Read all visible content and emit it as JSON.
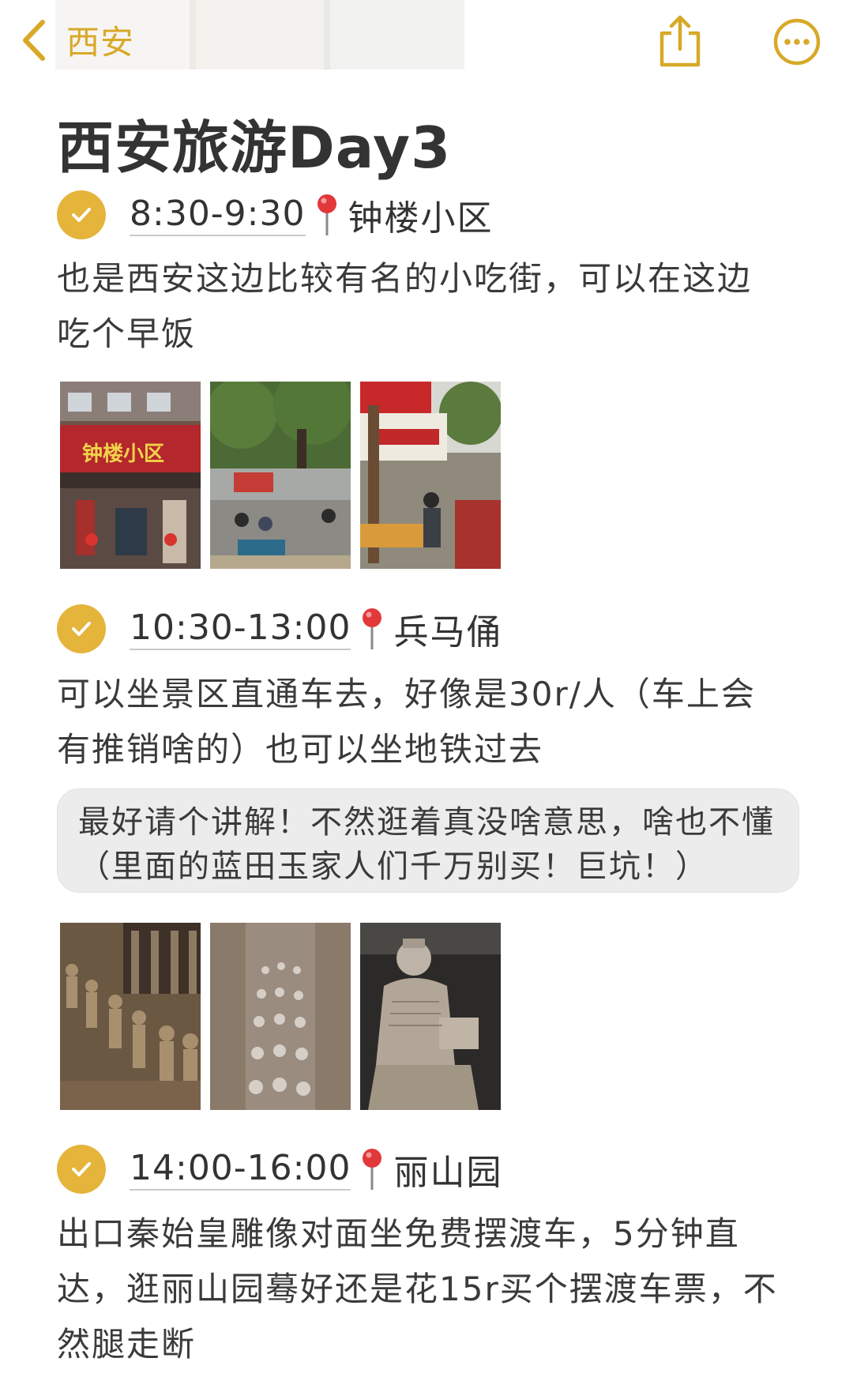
{
  "nav": {
    "back_label": "西安"
  },
  "title": "西安旅游Day3",
  "accent": "#e5b43b",
  "items": [
    {
      "time": "8:30-9:30",
      "place": "钟楼小区",
      "desc_lines": [
        "也是西安这边比较有名的小吃街，可以在这边",
        "吃个早饭"
      ],
      "photos": [
        "钟楼小区 storefront",
        "street with trees and crowd",
        "market stalls"
      ]
    },
    {
      "time": "10:30-13:00",
      "place": "兵马俑",
      "desc_lines": [
        "可以坐景区直通车去，好像是30r/人（车上会",
        "有推销啥的）也可以坐地铁过去"
      ],
      "note_lines": [
        "最好请个讲解！不然逛着真没啥意思，啥也不懂",
        "（里面的蓝田玉家人们千万别买！巨坑！）"
      ],
      "photos": [
        "terracotta warriors rows",
        "terracotta pit aerial",
        "kneeling archer statue"
      ]
    },
    {
      "time": "14:00-16:00",
      "place": "丽山园",
      "desc_lines": [
        "出口秦始皇雕像对面坐免费摆渡车，5分钟直",
        "达，逛丽山园蓦好还是花15r买个摆渡车票，不",
        "然腿走断"
      ]
    }
  ],
  "photo_sign_text": "钟楼小区"
}
